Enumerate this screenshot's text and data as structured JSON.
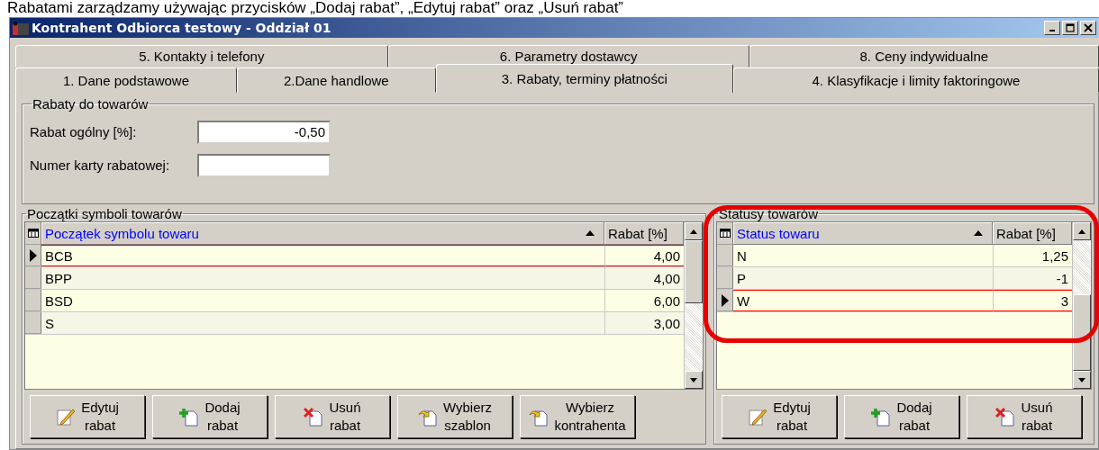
{
  "caption": "Rabatami zarządzamy używając przycisków „Dodaj rabat”, „Edytuj rabat” oraz „Usuń rabat”",
  "window": {
    "title": "Kontrahent Odbiorca testowy - Oddział 01"
  },
  "tab_rows": [
    [
      {
        "label": "5. Kontakty i telefony",
        "selected": false
      },
      {
        "label": "6. Parametry dostawcy",
        "selected": false
      },
      {
        "label": "8. Ceny indywidualne",
        "selected": false
      }
    ],
    [
      {
        "label": "1. Dane podstawowe",
        "selected": false
      },
      {
        "label": "2.Dane handlowe",
        "selected": false
      },
      {
        "label": "3. Rabaty, terminy płatności",
        "selected": true
      },
      {
        "label": "4. Klasyfikacje i limity faktoringowe",
        "selected": false
      }
    ]
  ],
  "discounts": {
    "legend": "Rabaty do towarów",
    "fields": [
      {
        "label": "Rabat ogólny [%]:",
        "value": "-0,50"
      },
      {
        "label": "Numer karty rabatowej:"
      }
    ]
  },
  "panels": [
    {
      "legend": "Początki symboli towarów",
      "highlighted": false,
      "columns": [
        {
          "label": "Początek symbolu towaru",
          "sorted": true
        },
        {
          "label": "Rabat [%]",
          "sorted": false
        }
      ],
      "rows": [
        {
          "cells": [
            "BCB",
            "4,00"
          ],
          "selected": true
        },
        {
          "cells": [
            "BPP",
            "4,00"
          ],
          "selected": false
        },
        {
          "cells": [
            "BSD",
            "6,00"
          ],
          "selected": false
        },
        {
          "cells": [
            "S",
            "3,00"
          ],
          "selected": false
        }
      ],
      "buttons": [
        {
          "kind": "edit",
          "lines": [
            "Edytuj",
            "rabat"
          ]
        },
        {
          "kind": "add",
          "lines": [
            "Dodaj",
            "rabat"
          ]
        },
        {
          "kind": "delete",
          "lines": [
            "Usuń",
            "rabat"
          ]
        },
        {
          "kind": "choose",
          "lines": [
            "Wybierz",
            "szablon"
          ]
        },
        {
          "kind": "choose",
          "lines": [
            "Wybierz",
            "kontrahenta"
          ]
        }
      ]
    },
    {
      "legend": "Statusy towarów",
      "highlighted": true,
      "columns": [
        {
          "label": "Status towaru",
          "sorted": true
        },
        {
          "label": "Rabat [%]",
          "sorted": false
        }
      ],
      "rows": [
        {
          "cells": [
            "N",
            "1,25"
          ],
          "selected": false
        },
        {
          "cells": [
            "P",
            "-1"
          ],
          "selected": false
        },
        {
          "cells": [
            "W",
            "3"
          ],
          "selected": true
        }
      ],
      "buttons": [
        {
          "kind": "edit",
          "lines": [
            "Edytuj",
            "rabat"
          ]
        },
        {
          "kind": "add",
          "lines": [
            "Dodaj",
            "rabat"
          ]
        },
        {
          "kind": "delete",
          "lines": [
            "Usuń",
            "rabat"
          ]
        }
      ]
    }
  ]
}
